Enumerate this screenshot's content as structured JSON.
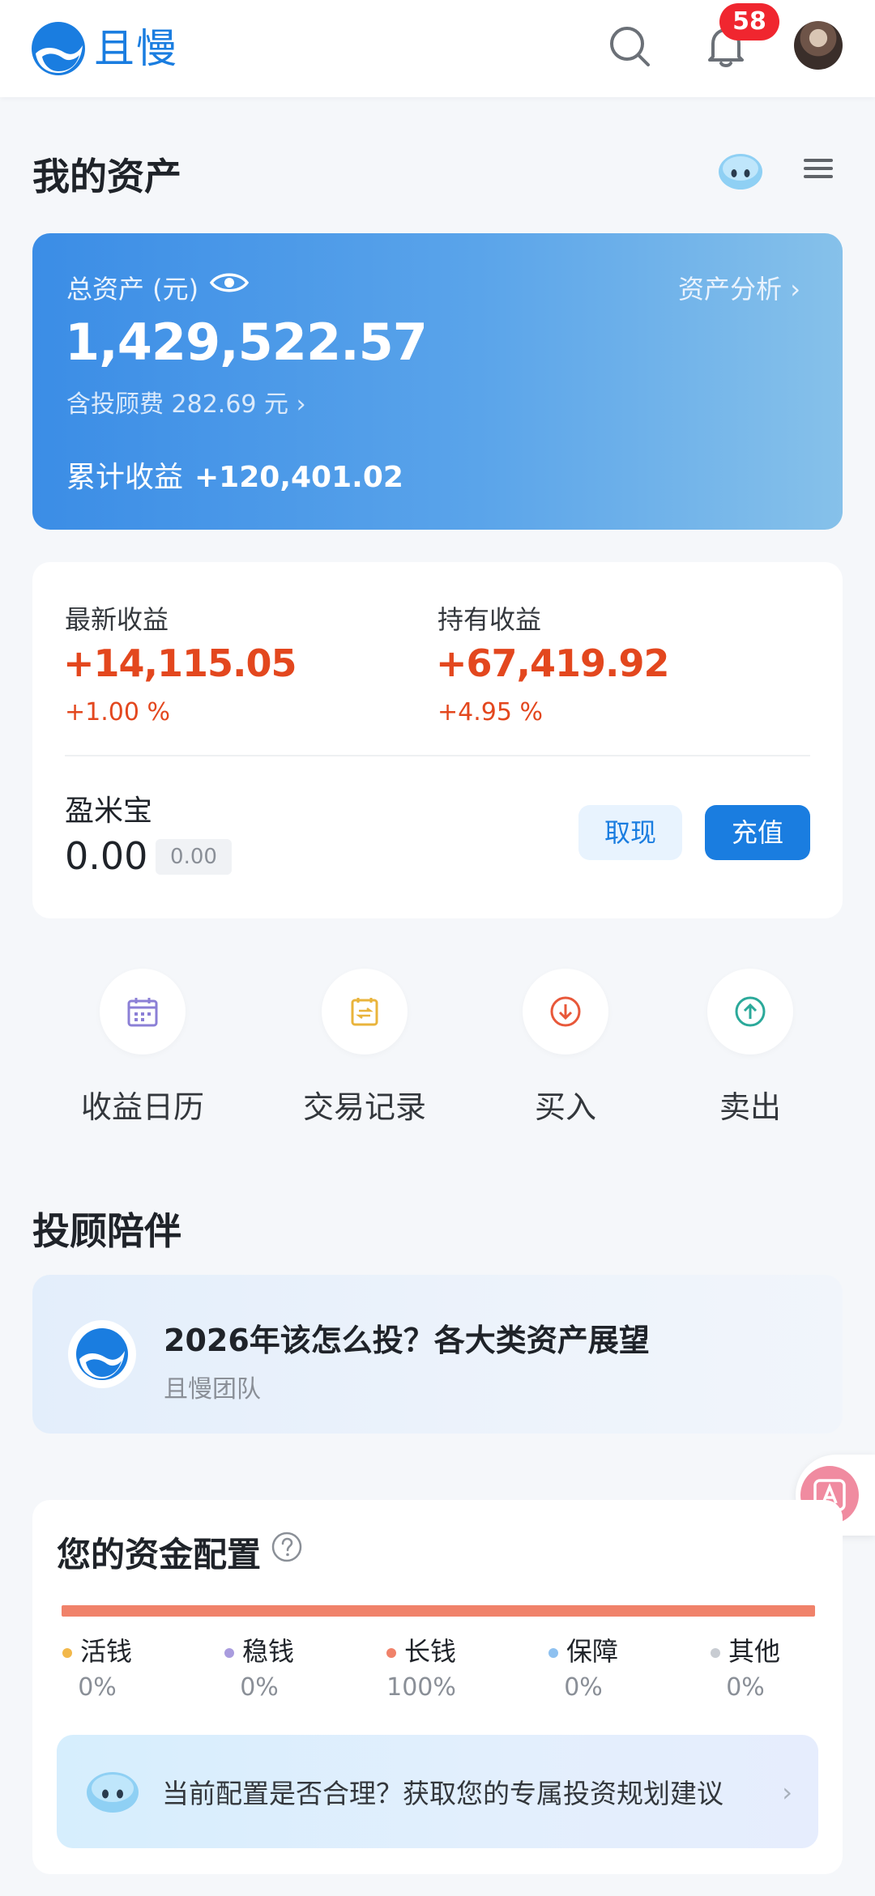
{
  "header": {
    "brand": "且慢",
    "notification_count": "58"
  },
  "assets": {
    "title": "我的资产",
    "total_label": "总资产 (元)",
    "analysis_link": "资产分析 ›",
    "total_value": "1,429,522.57",
    "fee_text": "含投顾费 282.69 元 ›",
    "cumulative_label": "累计收益",
    "cumulative_value": "+120,401.02"
  },
  "income": {
    "latest_label": "最新收益",
    "latest_value": "+14,115.05",
    "latest_pct": "+1.00 %",
    "holding_label": "持有收益",
    "holding_value": "+67,419.92",
    "holding_pct": "+4.95 %"
  },
  "yingmibao": {
    "label": "盈米宝",
    "value": "0.00",
    "chip": "0.00",
    "withdraw_label": "取现",
    "recharge_label": "充值"
  },
  "quick_actions": [
    {
      "label": "收益日历",
      "icon": "calendar-icon"
    },
    {
      "label": "交易记录",
      "icon": "receipt-icon"
    },
    {
      "label": "买入",
      "icon": "download-arrow-icon"
    },
    {
      "label": "卖出",
      "icon": "upload-arrow-icon"
    }
  ],
  "advisor": {
    "title": "投顾陪伴",
    "article_title": "2026年该怎么投？各大类资产展望",
    "article_author": "且慢团队"
  },
  "allocation": {
    "title": "您的资金配置",
    "long_money_fraction": 1.0,
    "categories": [
      {
        "name": "活钱",
        "pct": "0%",
        "color": "#f2b84a"
      },
      {
        "name": "稳钱",
        "pct": "0%",
        "color": "#a99cde"
      },
      {
        "name": "长钱",
        "pct": "100%",
        "color": "#f0826a"
      },
      {
        "name": "保障",
        "pct": "0%",
        "color": "#8ec1f0"
      },
      {
        "name": "其他",
        "pct": "0%",
        "color": "#c8ccd2"
      }
    ],
    "advice_text": "当前配置是否合理？获取您的专属投资规划建议",
    "advice_arrow": "›"
  },
  "colors": {
    "brand_blue": "#1a7de0",
    "gain_red": "#e3471e",
    "badge_red": "#f0262f"
  }
}
